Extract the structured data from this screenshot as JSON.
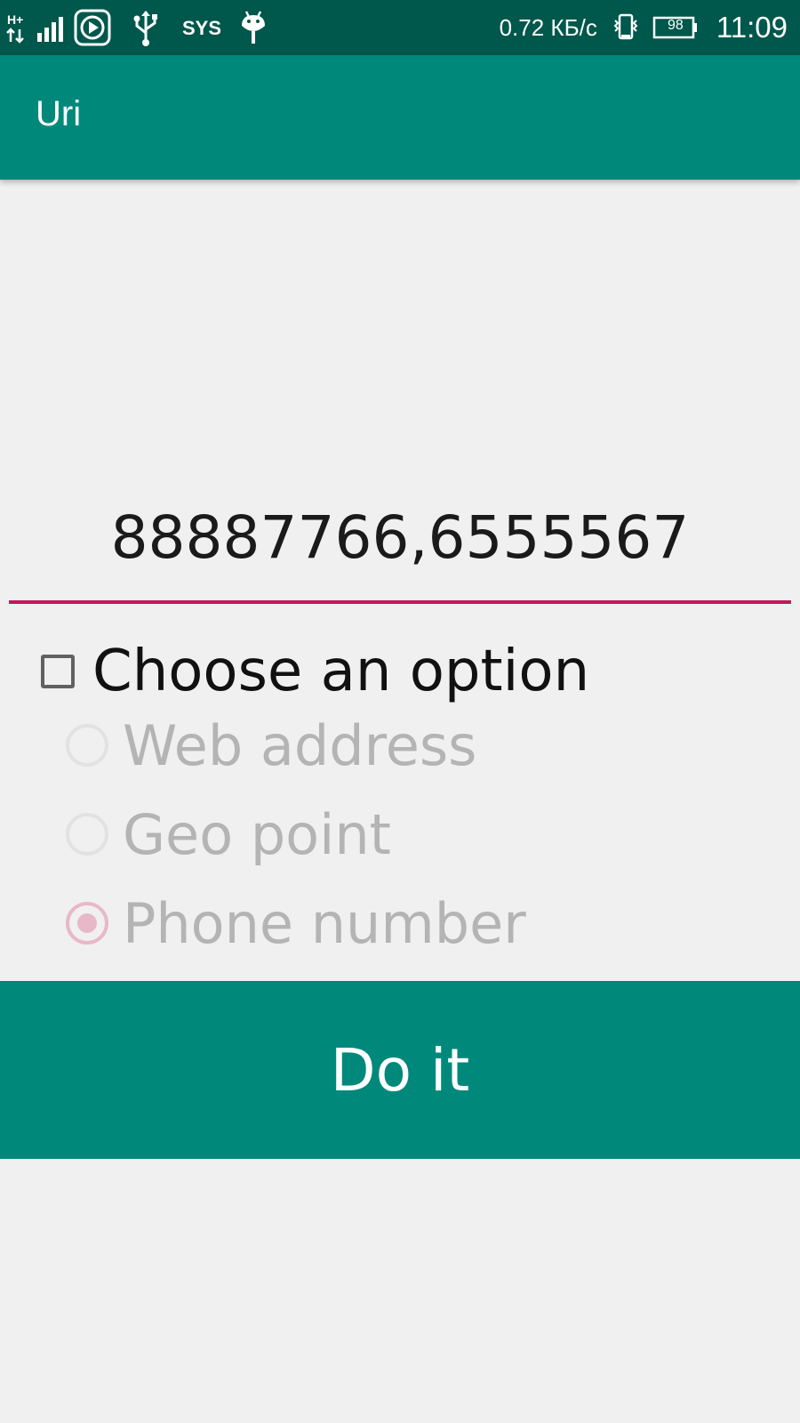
{
  "status_bar": {
    "network_type": "H+",
    "data_speed": "0.72 КБ/с",
    "battery_level": "98",
    "time": "11:09",
    "left_icons": [
      "network-hplus-icon",
      "signal-icon",
      "media-icon",
      "usb-icon",
      "sms-icon",
      "android-icon"
    ],
    "right_icons": [
      "vibrate-icon",
      "battery-icon"
    ]
  },
  "app_bar": {
    "title": "Uri"
  },
  "input": {
    "value": "88887766,6555567"
  },
  "options": {
    "checkbox_label": "Choose an option",
    "checkbox_checked": false,
    "radio_items": [
      {
        "label": "Web address",
        "checked": false
      },
      {
        "label": "Geo point",
        "checked": false
      },
      {
        "label": "Phone number",
        "checked": true
      }
    ]
  },
  "action": {
    "button_label": "Do it"
  },
  "colors": {
    "status_bar": "#00574b",
    "primary": "#00897b",
    "accent": "#c2185b",
    "background": "#f0f0f0",
    "disabled_text": "#b4b4b4"
  }
}
